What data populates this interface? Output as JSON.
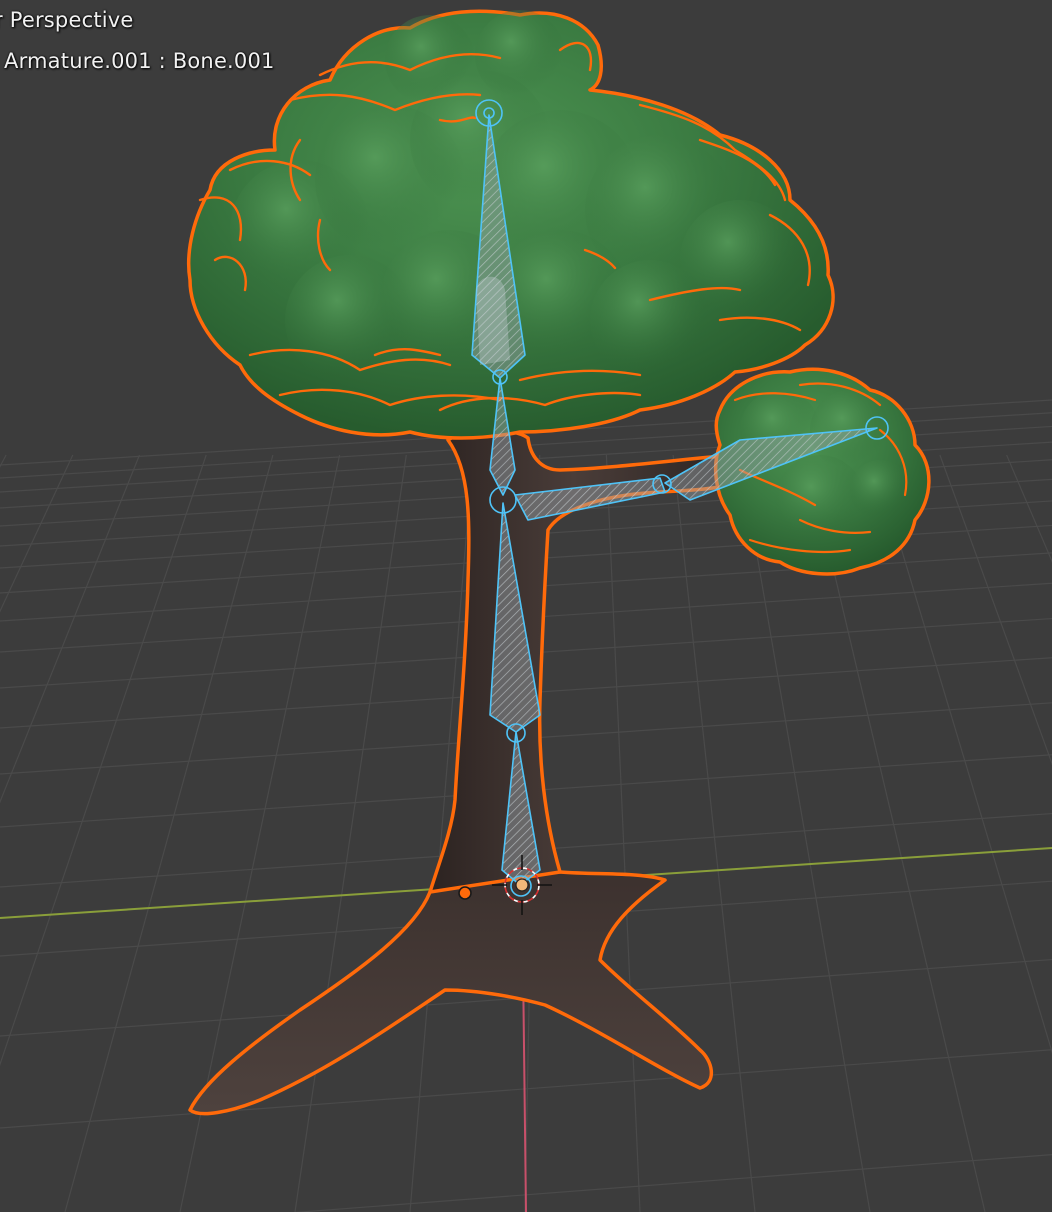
{
  "viewport": {
    "view_name": "r Perspective",
    "active_object": "Armature.001 : Bone.001"
  },
  "colors": {
    "background": "#3c3c3c",
    "grid_line": "#4a4a4a",
    "x_axis": "#8a9f3a",
    "y_axis": "#c8506a",
    "selection_outline": "#ff6a0a",
    "bone_outline": "#4fc3f7",
    "foliage": "#3f7e45",
    "trunk": "#3d302d"
  },
  "icons": {
    "origin": "object-origin-icon",
    "cursor_3d": "3d-cursor-icon"
  }
}
